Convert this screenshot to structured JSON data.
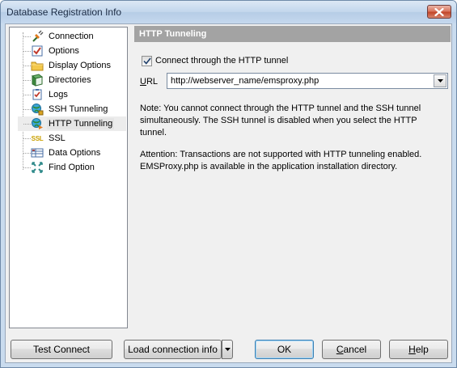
{
  "window": {
    "title": "Database Registration Info"
  },
  "sidebar": {
    "items": [
      {
        "label": "Connection",
        "icon": "connection-plug-icon"
      },
      {
        "label": "Options",
        "icon": "options-checklist-icon"
      },
      {
        "label": "Display Options",
        "icon": "folder-icon"
      },
      {
        "label": "Directories",
        "icon": "directories-book-icon"
      },
      {
        "label": "Logs",
        "icon": "logs-checklist-icon"
      },
      {
        "label": "SSH Tunneling",
        "icon": "ssh-globe-icon"
      },
      {
        "label": "HTTP Tunneling",
        "icon": "http-globe-icon",
        "selected": true
      },
      {
        "label": "SSL",
        "icon": "ssl-text-icon",
        "icon_text": "SSL"
      },
      {
        "label": "Data Options",
        "icon": "data-options-grid-icon"
      },
      {
        "label": "Find Option",
        "icon": "find-arrows-icon"
      }
    ]
  },
  "panel": {
    "header": "HTTP Tunneling",
    "checkbox_label": "Connect through the HTTP tunnel",
    "checkbox_checked": true,
    "url_label_u": "U",
    "url_label_rl": "RL",
    "url_value": "http://webserver_name/emsproxy.php",
    "note_line1": "Note: You cannot connect through the HTTP tunnel and the SSH tunnel",
    "note_line2": "simultaneously. The SSH tunnel is disabled  when you select the HTTP",
    "note_line3": "tunnel.",
    "attention_line1": "Attention: Transactions are not supported with HTTP tunneling enabled.",
    "attention_line2": "EMSProxy.php is available in the application installation directory."
  },
  "buttons": {
    "test_connect": "Test Connect",
    "load_connection_info": "Load connection info",
    "ok": "OK",
    "cancel_u": "C",
    "cancel_rest": "ancel",
    "help_u": "H",
    "help_rest": "elp"
  },
  "colors": {
    "header_bg": "#a3a3a3",
    "window_frame": "#c9dbee",
    "close_red": "#c2462a"
  }
}
